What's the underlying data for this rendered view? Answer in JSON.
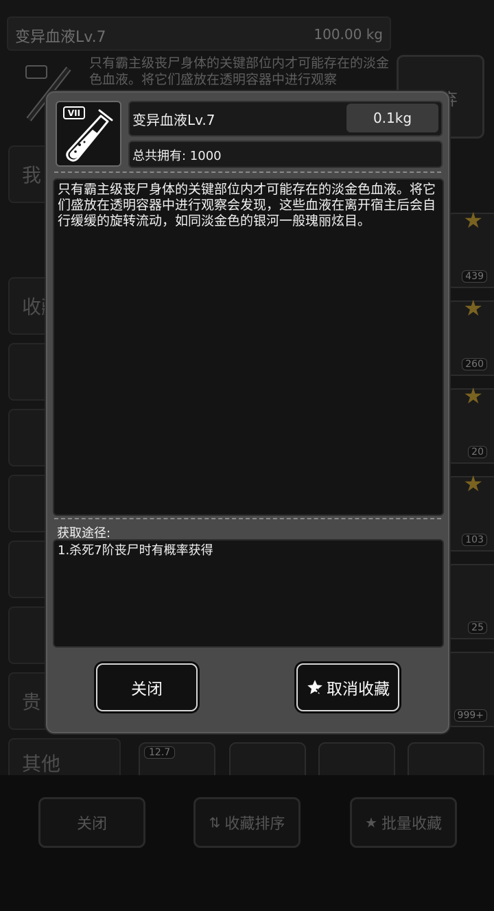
{
  "background": {
    "item_name": "变异血液Lv.7",
    "item_weight": "100.00 kg",
    "item_desc": "只有霸主级丧尸身体的关键部位内才可能存在的淡金色血液。将它们盛放在透明容器中进行观察",
    "use_button": "丢弃",
    "categories": [
      "我",
      "收藏",
      "贵",
      "其他"
    ],
    "slot_counts": [
      "439",
      "260",
      "20",
      "103",
      "25",
      "999+"
    ],
    "row_tag": "12.7",
    "bottom_buttons": {
      "close": "关闭",
      "sort": "收藏排序",
      "batch": "批量收藏"
    }
  },
  "modal": {
    "icon_badge": "VII",
    "item_name": "变异血液Lv.7",
    "weight": "0.1kg",
    "owned": "总共拥有: 1000",
    "description": "只有霸主级丧尸身体的关键部位内才可能存在的淡金色血液。将它们盛放在透明容器中进行观察会发现，这些血液在离开宿主后会自行缓缓的旋转流动，如同淡金色的银河一般瑰丽炫目。",
    "source_label": "获取途径:",
    "source_text": "1.杀死7阶丧尸时有概率获得",
    "close_button": "关闭",
    "unfavorite_button": "取消收藏"
  },
  "icons": {
    "item": "test-tube-icon",
    "unfavorite": "star-icon"
  },
  "colors": {
    "modal_bg": "#4a4a4a",
    "panel_bg": "#141414",
    "text": "#f2f2f2",
    "star_gold": "#7a6320"
  }
}
